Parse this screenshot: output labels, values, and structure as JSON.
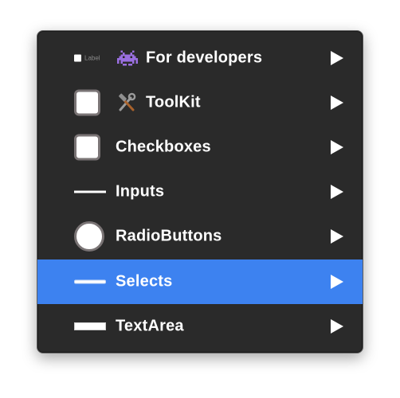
{
  "menu": {
    "items": [
      {
        "label": "For developers",
        "icon": "space-invader-emoji-icon",
        "preview_label": "Label",
        "has_submenu": true,
        "selected": false
      },
      {
        "label": "ToolKit",
        "icon": "hammer-and-wrench-emoji-icon",
        "has_submenu": true,
        "selected": false
      },
      {
        "label": "Checkboxes",
        "has_submenu": true,
        "selected": false
      },
      {
        "label": "Inputs",
        "has_submenu": true,
        "selected": false
      },
      {
        "label": "RadioButtons",
        "has_submenu": true,
        "selected": false
      },
      {
        "label": "Selects",
        "has_submenu": true,
        "selected": true
      },
      {
        "label": "TextArea",
        "has_submenu": true,
        "selected": false
      }
    ]
  },
  "colors": {
    "menu_background": "#2a2a2a",
    "selection": "#3d82f0",
    "text": "#ffffff"
  }
}
